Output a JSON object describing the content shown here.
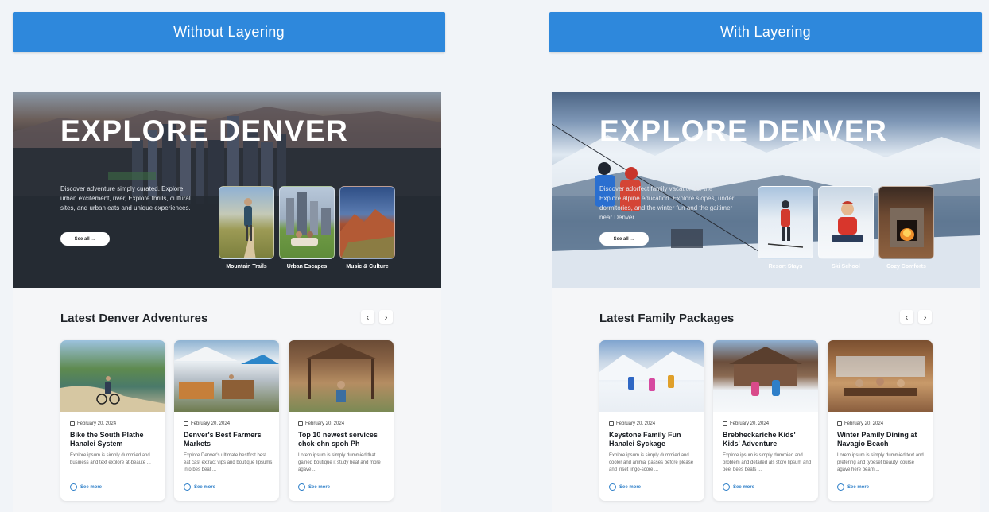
{
  "buttons": {
    "left": "Without Layering",
    "right": "With Layering"
  },
  "left_panel": {
    "hero_title": "EXPLORE DENVER",
    "hero_desc": "Discover adventure simply curated. Explore urban excitement, river, Explore thrills, cultural sites, and urban eats and unique experiences.",
    "see_all": "See all →",
    "tiles": [
      "Mountain Trails",
      "Urban Escapes",
      "Music & Culture"
    ],
    "section_title": "Latest Denver Adventures",
    "prev": "‹",
    "next": "›",
    "cards": [
      {
        "date": "February 20, 2024",
        "title": "Bike the South Plathe Hanalei System",
        "text": "Explore ipsum is simply dummied and business and text explore at-beaute ...",
        "more": "See more"
      },
      {
        "date": "February 20, 2024",
        "title": "Denver's Best Farmers Markets",
        "text": "Explore Denver's ultimate bestfirst best eat cast extract vips and boutique lipsums into bes beat ...",
        "more": "See more"
      },
      {
        "date": "February 20, 2024",
        "title": "Top 10 newest services chck-chn spoh Ph",
        "text": "Lorem ipsum is simply dummied that gained boutique it study beat and more agave ...",
        "more": "See more"
      }
    ]
  },
  "right_panel": {
    "hero_title": "EXPLORE DENVER",
    "hero_desc": "Discover adorfect family vacation for the Explore alpine education. Explore slopes, under dormitories, and the winter fun and the gaitimer near Denver.",
    "see_all": "See all →",
    "tiles": [
      "Resort Stays",
      "Ski School",
      "Cozy Comforts"
    ],
    "section_title": "Latest Family Packages",
    "prev": "‹",
    "next": "›",
    "cards": [
      {
        "date": "February 20, 2024",
        "title": "Keystone Family Fun Hanalei Syckage",
        "text": "Explore ipsum is simply dummied and cooler and animal passes before please and inset lingo-score ...",
        "more": "See more"
      },
      {
        "date": "February 20, 2024",
        "title": "Brebheckariche Kids' Kids' Adventure",
        "text": "Explore ipsum is simply dummied and problem and detailed als store lipsum and peel bees beats ...",
        "more": "See more"
      },
      {
        "date": "February 20, 2024",
        "title": "Winter Pamily Dining at Navagio Beach",
        "text": "Lorem ipsum is simply dummied text and prefering and typeset beauty, course agave here beam ...",
        "more": "See more"
      }
    ]
  }
}
